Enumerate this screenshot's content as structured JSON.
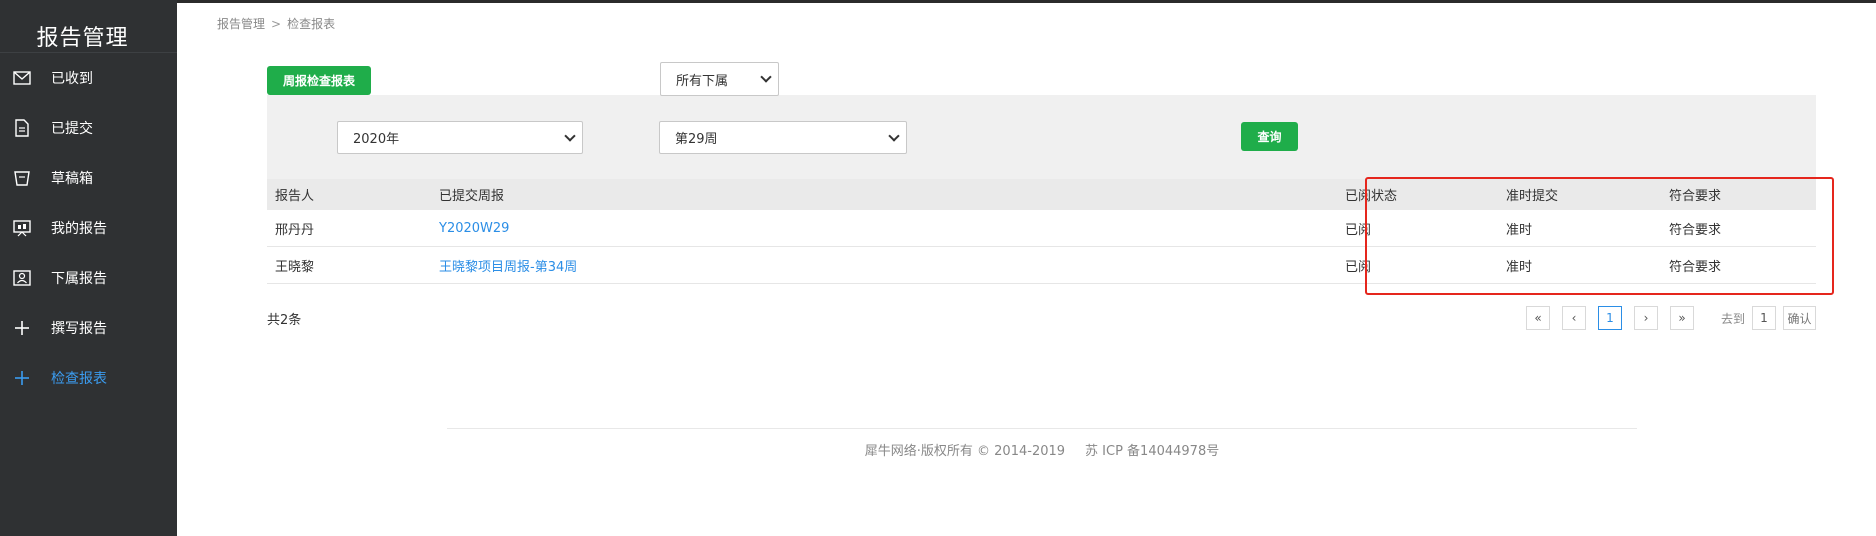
{
  "sidebar": {
    "title": "报告管理",
    "items": [
      {
        "label": "已收到",
        "icon": "envelope-icon"
      },
      {
        "label": "已提交",
        "icon": "document-icon"
      },
      {
        "label": "草稿箱",
        "icon": "draft-box-icon"
      },
      {
        "label": "我的报告",
        "icon": "presentation-icon"
      },
      {
        "label": "下属报告",
        "icon": "id-card-icon"
      },
      {
        "label": "撰写报告",
        "icon": "plus-icon"
      },
      {
        "label": "检查报表",
        "icon": "plus-icon",
        "active": true
      }
    ]
  },
  "breadcrumb": {
    "home": "报告管理",
    "separator": ">",
    "current": "检查报表"
  },
  "toolbar": {
    "weekly_check_button": "周报检查报表",
    "subordinate_select": "所有下属"
  },
  "filters": {
    "year": "2020年",
    "week": "第29周",
    "query_button": "查询"
  },
  "table": {
    "headers": {
      "reporter": "报告人",
      "report": "已提交周报",
      "read_status": "已阅状态",
      "on_time": "准时提交",
      "meets": "符合要求"
    },
    "rows": [
      {
        "reporter": "邢丹丹",
        "report": "Y2020W29",
        "read_status": "已阅",
        "on_time": "准时",
        "meets": "符合要求"
      },
      {
        "reporter": "王晓黎",
        "report": "王晓黎项目周报-第34周",
        "read_status": "已阅",
        "on_time": "准时",
        "meets": "符合要求"
      }
    ]
  },
  "total": "共2条",
  "pagination": {
    "first": "«",
    "prev": "‹",
    "current": "1",
    "next": "›",
    "last": "»",
    "goto_label": "去到",
    "goto_value": "1",
    "confirm": "确认"
  },
  "footer": {
    "copyright": "犀牛网络·版权所有 © 2014-2019",
    "icp": "苏 ICP 备14044978号"
  },
  "colors": {
    "sidebar_bg": "#2f3133",
    "accent_green": "#1fad4a",
    "link_blue": "#2b8ee6",
    "highlight_red": "#e5261d"
  }
}
